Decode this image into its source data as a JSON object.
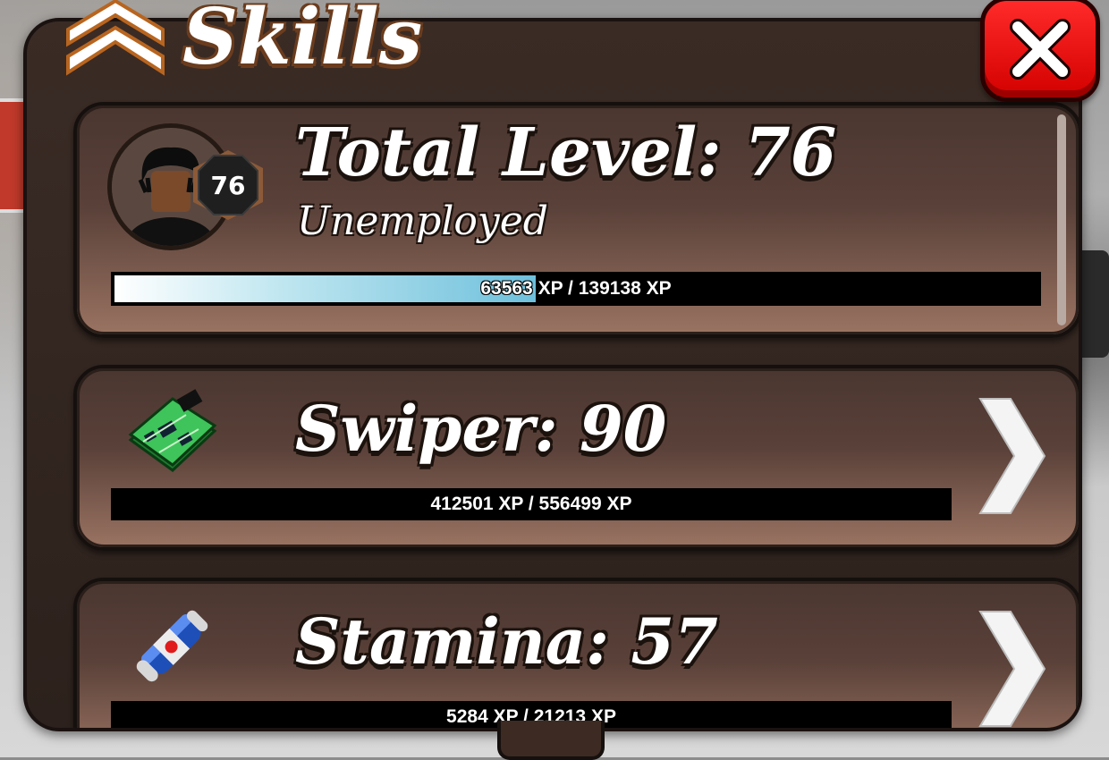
{
  "panel": {
    "title": "Skills",
    "close_label": "close"
  },
  "total": {
    "title": "Total Level: 76",
    "job": "Unemployed",
    "badge_level": "76",
    "xp_text": "63563 XP / 139138 XP",
    "xp_current": 63563,
    "xp_max": 139138
  },
  "skills": [
    {
      "title": "Swiper: 90",
      "icon": "circuit-board-icon",
      "xp_text": "412501 XP / 556499 XP",
      "xp_current": 412501,
      "xp_max": 556499
    },
    {
      "title": "Stamina: 57",
      "icon": "energy-drink-can-icon",
      "xp_text": "5284 XP / 21213 XP",
      "xp_current": 5284,
      "xp_max": 21213
    }
  ],
  "colors": {
    "close_button": "#ff2a2a",
    "xp_fill": "#6ec0dc",
    "card": "#5a4139"
  }
}
